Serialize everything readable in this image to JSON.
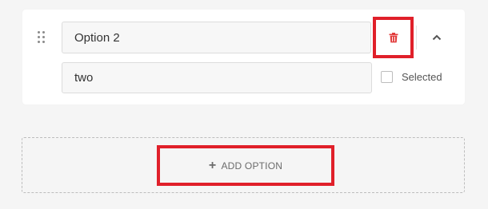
{
  "option": {
    "label_value": "Option 2",
    "value_value": "two",
    "selected_label": "Selected",
    "selected": false
  },
  "icons": {
    "drag": "drag-handle-icon",
    "delete": "trash-icon",
    "collapse": "chevron-up-icon",
    "add": "plus-icon"
  },
  "add_option": {
    "label": "ADD OPTION"
  },
  "colors": {
    "highlight": "#e0202a",
    "delete_icon": "#e23c3c",
    "background": "#f5f5f5",
    "card": "#ffffff"
  }
}
